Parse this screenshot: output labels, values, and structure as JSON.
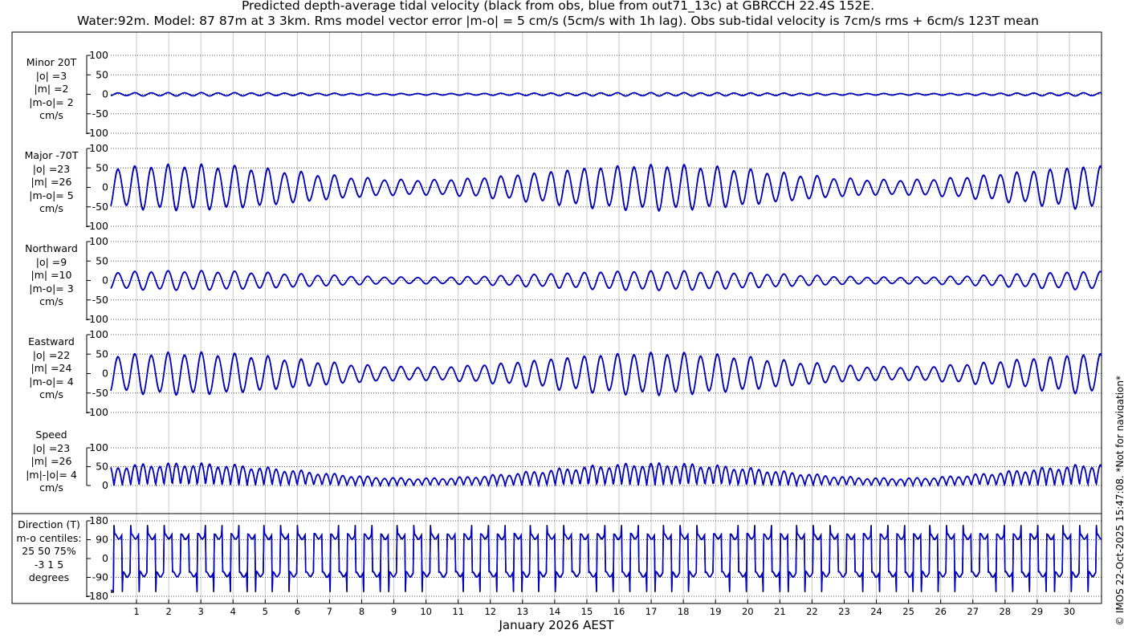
{
  "title_line1": "Predicted depth-average tidal velocity (black from obs, blue from out71_13c) at GBRCCH 22.4S 152E.",
  "title_line2": "Water:92m. Model: 87 87m at 3 3km. Rms model vector error |m-o| = 5 cm/s (5cm/s with 1h lag). Obs sub-tidal velocity is 7cm/s rms + 6cm/s 123T mean",
  "copyright": "© IMOS 22-Oct-2025 15:47:08. *Not for navigation*",
  "panels": [
    {
      "id": "minor",
      "label_lines": [
        "Minor 20T",
        "|o| =3",
        "|m| =2",
        "|m-o|= 2",
        "cm/s"
      ]
    },
    {
      "id": "major",
      "label_lines": [
        "Major -70T",
        "|o| =23",
        "|m| =26",
        "|m-o|= 5",
        "cm/s"
      ]
    },
    {
      "id": "north",
      "label_lines": [
        "Northward",
        "|o| =9",
        "|m| =10",
        "|m-o|= 3",
        "cm/s"
      ]
    },
    {
      "id": "east",
      "label_lines": [
        "Eastward",
        "|o| =22",
        "|m| =24",
        "|m-o|= 4",
        "cm/s"
      ]
    },
    {
      "id": "speed",
      "label_lines": [
        "Speed",
        "|o| =23",
        "|m| =26",
        "|m|-|o|= 4",
        "cm/s"
      ]
    },
    {
      "id": "dir",
      "label_lines": [
        "Direction (T)",
        "m-o centiles:",
        "25  50  75%",
        "-3  1  5",
        "degrees"
      ]
    }
  ],
  "chart_data": {
    "type": "line",
    "xlabel": "January 2026 AEST",
    "x_ticks": [
      "1",
      "2",
      "3",
      "4",
      "5",
      "6",
      "7",
      "8",
      "9",
      "10",
      "11",
      "12",
      "13",
      "14",
      "15",
      "16",
      "17",
      "18",
      "19",
      "20",
      "21",
      "22",
      "23",
      "24",
      "25",
      "26",
      "27",
      "28",
      "29",
      "30"
    ],
    "xlim_days": [
      0.2,
      31.0
    ],
    "series": [
      {
        "name": "obs",
        "color": "#000000"
      },
      {
        "name": "out71_13c",
        "color": "#0000cc"
      }
    ],
    "tidal_model": {
      "period_hours": 12.42,
      "spring_neap_period_days": 14.77,
      "spring_days": [
        2.5,
        17.2,
        30.0
      ],
      "phase_ref_day": 0.3
    },
    "panels": [
      {
        "id": "minor",
        "ylim": [
          -100,
          100
        ],
        "yticks": [
          "100",
          "50",
          "0",
          "-50",
          "-100"
        ],
        "amp_spring": 4,
        "amp_neap": 2,
        "mean": 0
      },
      {
        "id": "major",
        "ylim": [
          -100,
          100
        ],
        "yticks": [
          "100",
          "50",
          "0",
          "-50",
          "-100"
        ],
        "amp_spring": 54,
        "amp_neap": 18,
        "mean": 0
      },
      {
        "id": "north",
        "ylim": [
          -100,
          100
        ],
        "yticks": [
          "100",
          "50",
          "0",
          "-50",
          "-100"
        ],
        "amp_spring": 23,
        "amp_neap": 8,
        "mean": 0
      },
      {
        "id": "east",
        "ylim": [
          -100,
          100
        ],
        "yticks": [
          "100",
          "50",
          "0",
          "-50",
          "-100"
        ],
        "amp_spring": 50,
        "amp_neap": 16,
        "mean": 0
      },
      {
        "id": "speed",
        "ylim": [
          0,
          100
        ],
        "yticks": [
          "100",
          "50",
          "0"
        ],
        "amp_spring": 54,
        "amp_neap": 18
      },
      {
        "id": "dir",
        "ylim": [
          -180,
          180
        ],
        "yticks": [
          "180",
          "90",
          "0",
          "-90",
          "-180"
        ],
        "high_deg": 105,
        "low_deg": -75
      }
    ]
  }
}
